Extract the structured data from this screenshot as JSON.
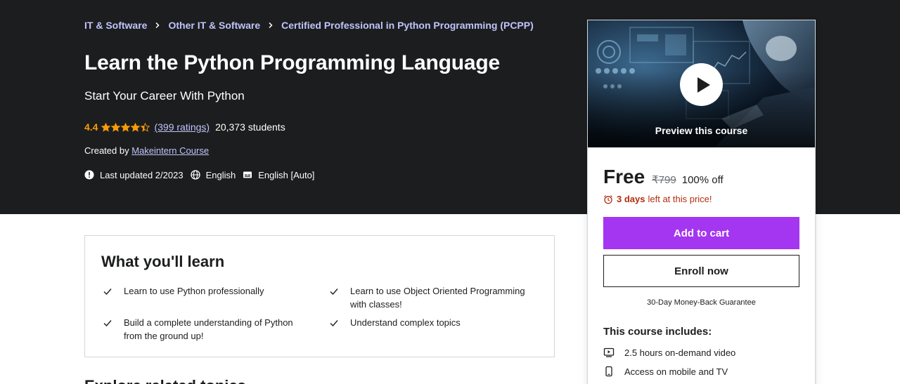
{
  "breadcrumb": [
    {
      "label": "IT & Software"
    },
    {
      "label": "Other IT & Software"
    },
    {
      "label": "Certified Professional in Python Programming (PCPP)"
    }
  ],
  "course": {
    "title": "Learn the Python Programming Language",
    "subtitle": "Start Your Career With Python",
    "rating": "4.4",
    "stars_value": 4.4,
    "stars_max": 5,
    "ratings_count": "(399 ratings)",
    "students": "20,373 students",
    "created_by_label": "Created by",
    "instructor": "Makeintern Course",
    "last_updated": "Last updated 2/2023",
    "language": "English",
    "captions": "English [Auto]"
  },
  "learn": {
    "title": "What you'll learn",
    "items": [
      "Learn to use Python professionally",
      "Learn to use Object Oriented Programming with classes!",
      "Build a complete understanding of Python from the ground up!",
      "Understand complex topics"
    ]
  },
  "next_section": {
    "title": "Explore related topics"
  },
  "sidebar": {
    "preview_label": "Preview this course",
    "price": "Free",
    "original_price": "₹799",
    "discount": "100% off",
    "timer_bold": "3 days",
    "timer_rest": "left at this price!",
    "add_to_cart": "Add to cart",
    "enroll_now": "Enroll now",
    "guarantee": "30-Day Money-Back Guarantee",
    "includes_title": "This course includes:",
    "includes": [
      {
        "icon": "video-icon",
        "label": "2.5 hours on-demand video"
      },
      {
        "icon": "mobile-icon",
        "label": "Access on mobile and TV"
      }
    ]
  },
  "colors": {
    "hero_bg": "#1c1d1f",
    "link": "#c0c4fc",
    "star": "#f69c08",
    "accent": "#a435f0",
    "timer": "#b32d0f"
  }
}
